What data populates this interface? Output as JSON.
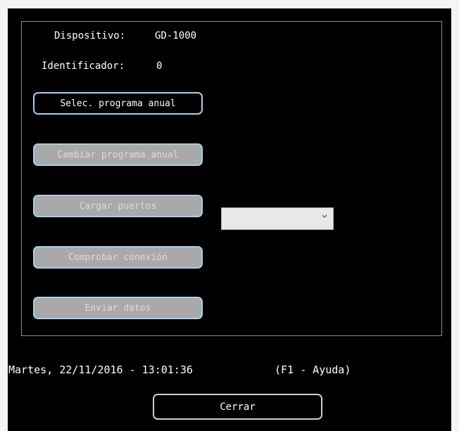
{
  "device": {
    "label": "Dispositivo:",
    "value": "GD-1000"
  },
  "identifier": {
    "label": "Identificador:",
    "value": "0"
  },
  "buttons": {
    "select_program": "Selec. programa anual",
    "change_program": "Cambiar programa anual",
    "load_ports": "Cargar puertos",
    "check_connection": "Comprobar conexión",
    "send_data": "Enviar datos",
    "close": "Cerrar"
  },
  "ports_select": {
    "selected": ""
  },
  "status": {
    "datetime": "Martes, 22/11/2016 - 13:01:36",
    "help": "(F1 - Ayuda)"
  },
  "icons": {
    "dropdown": "chevron-down-icon"
  },
  "colors": {
    "background": "#000000",
    "button_border": "#a6d0e6",
    "disabled_button": "#a9a9a9"
  }
}
